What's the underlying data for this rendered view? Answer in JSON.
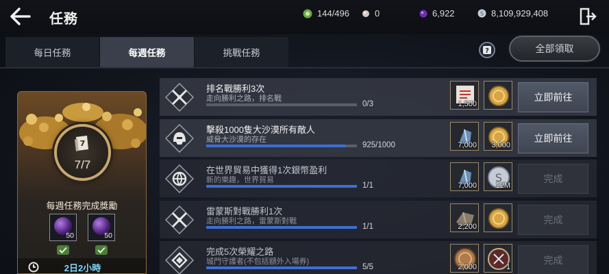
{
  "header": {
    "title": "任務",
    "resources": [
      {
        "icon": "green-stamina-icon",
        "value": "144/496"
      },
      {
        "icon": "pearl-icon",
        "value": "0"
      },
      {
        "icon": "purple-orb-icon",
        "value": "6,922"
      },
      {
        "icon": "silver-coin-icon",
        "value": "8,109,929,408"
      }
    ]
  },
  "tabs": [
    {
      "label": "每日任務",
      "active": false
    },
    {
      "label": "每週任務",
      "active": true
    },
    {
      "label": "挑戰任務",
      "active": false
    }
  ],
  "claim_all_label": "全部領取",
  "weekly_card": {
    "count": "7/7",
    "label": "每週任務完成獎勵",
    "rewards": [
      {
        "icon": "purple-orb-icon",
        "qty": "50"
      },
      {
        "icon": "purple-orb-icon",
        "qty": "50"
      }
    ],
    "timer": "2日2小時"
  },
  "missions": [
    {
      "icon": "crossed-swords-icon",
      "title": "排名戰勝利3次",
      "subtitle": "走向勝利之路，排名戰",
      "progress": "0/3",
      "fill": 0,
      "rewards": [
        {
          "icon": "certificate-icon",
          "qty": "1,500"
        },
        {
          "icon": "gold-coin-icon",
          "qty": ""
        }
      ],
      "button": "立即前往",
      "done": false
    },
    {
      "icon": "helmet-icon",
      "title": "擊殺1000隻大沙漠所有敵人",
      "subtitle": "威脅大沙漠的存在",
      "progress": "925/1000",
      "fill": 0.925,
      "rewards": [
        {
          "icon": "crystal-icon",
          "qty": "7,000"
        },
        {
          "icon": "gold-coin-icon",
          "qty": "3,000"
        }
      ],
      "button": "立即前往",
      "done": false
    },
    {
      "icon": "globe-trade-icon",
      "title": "在世界貿易中獲得1次銀幣盈利",
      "subtitle": "新的樂趣，世界貿易",
      "progress": "1/1",
      "fill": 1,
      "rewards": [
        {
          "icon": "crystal-icon",
          "qty": "7,000"
        },
        {
          "icon": "silver-coin-icon",
          "qty": "12M"
        }
      ],
      "button": "完成",
      "done": true
    },
    {
      "icon": "crossed-swords-icon",
      "title": "雷蒙斯對戰勝利1次",
      "subtitle": "走向勝利之路，雷蒙斯對戰",
      "progress": "1/1",
      "fill": 1,
      "rewards": [
        {
          "icon": "stone-icon",
          "qty": "2,200"
        },
        {
          "icon": "gold-coin-icon",
          "qty": ""
        }
      ],
      "button": "完成",
      "done": true
    },
    {
      "icon": "diamond-emblem-icon",
      "title": "完成5次榮耀之路",
      "subtitle": "城門守護者(不包括額外入場券)",
      "progress": "5/5",
      "fill": 1,
      "rewards": [
        {
          "icon": "bronze-coin-icon",
          "qty": "2,000"
        },
        {
          "icon": "dark-medal-icon",
          "qty": "1"
        }
      ],
      "button": "完成",
      "done": true
    }
  ]
}
